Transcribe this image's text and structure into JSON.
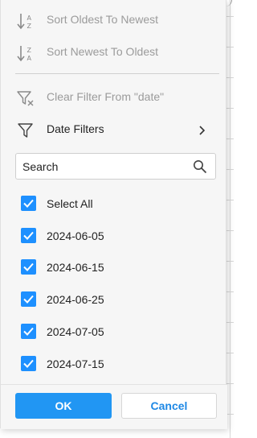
{
  "menu": {
    "sort_asc": {
      "label": "Sort Oldest To Newest",
      "icon": "sort-ascending-icon",
      "enabled": false
    },
    "sort_desc": {
      "label": "Sort Newest To Oldest",
      "icon": "sort-descending-icon",
      "enabled": false
    },
    "clear_filter": {
      "label": "Clear Filter From \"date\"",
      "icon": "clear-filter-icon",
      "enabled": false
    },
    "date_filters": {
      "label": "Date Filters",
      "icon": "filter-icon",
      "submenu_icon": "chevron-right-icon"
    }
  },
  "search": {
    "placeholder": "Search",
    "value": "",
    "icon": "search-icon"
  },
  "options": [
    {
      "label": "Select All",
      "checked": true
    },
    {
      "label": "2024-06-05",
      "checked": true
    },
    {
      "label": "2024-06-15",
      "checked": true
    },
    {
      "label": "2024-06-25",
      "checked": true
    },
    {
      "label": "2024-07-05",
      "checked": true
    },
    {
      "label": "2024-07-15",
      "checked": true
    }
  ],
  "buttons": {
    "ok_label": "OK",
    "cancel_label": "Cancel"
  },
  "colors": {
    "accent": "#2196f3",
    "checkbox": "#1e90ff",
    "disabled_text": "#9b9b9b"
  }
}
